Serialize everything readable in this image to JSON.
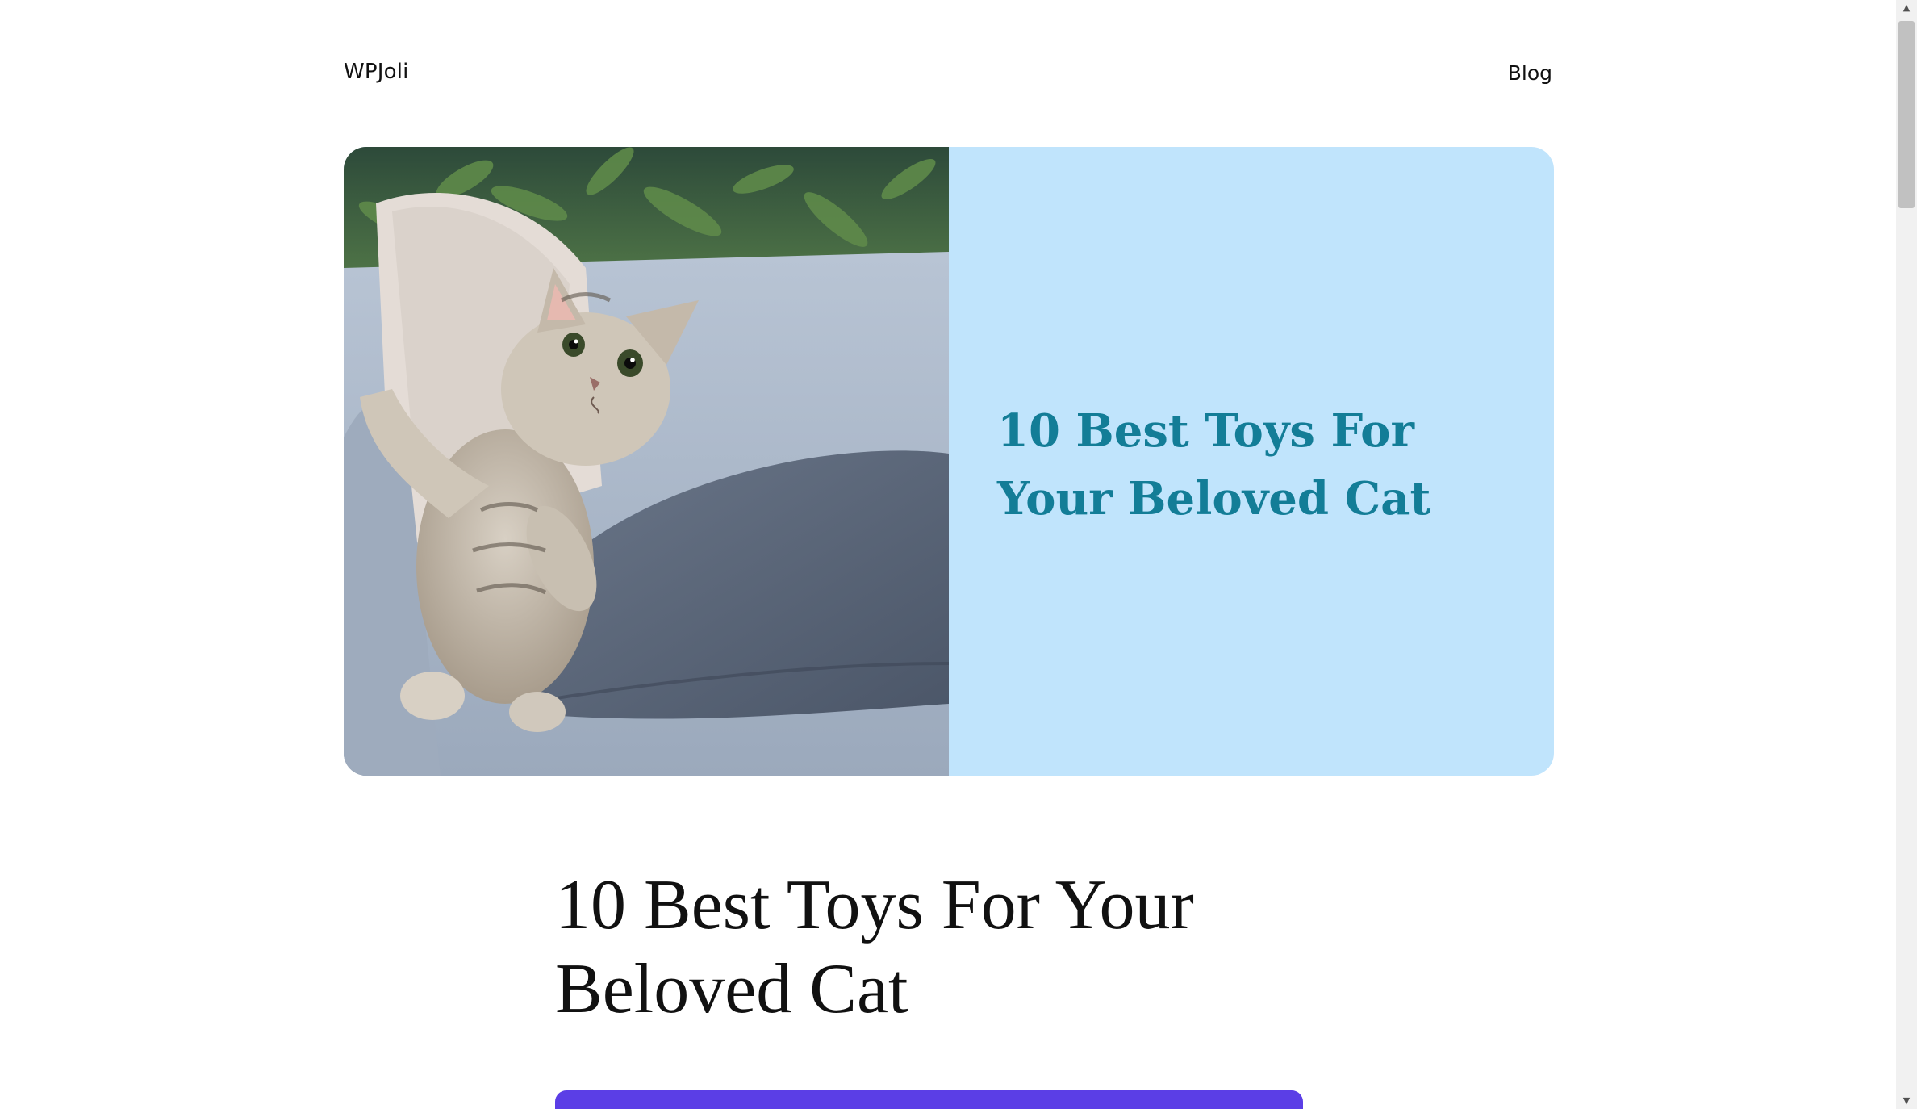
{
  "header": {
    "site_title": "WPJoli",
    "nav": [
      {
        "label": "Blog"
      }
    ]
  },
  "hero": {
    "image_alt": "kitten sitting on a sofa",
    "panel_text": "10 Best Toys For Your Beloved Cat",
    "panel_bg": "#c0e4fc",
    "panel_text_color": "#137d97"
  },
  "post": {
    "title": "10 Best Toys For Your Beloved Cat"
  },
  "cta": {
    "color": "#5b3ee6"
  },
  "scrollbar": {
    "up_icon": "▲",
    "down_icon": "▼"
  }
}
